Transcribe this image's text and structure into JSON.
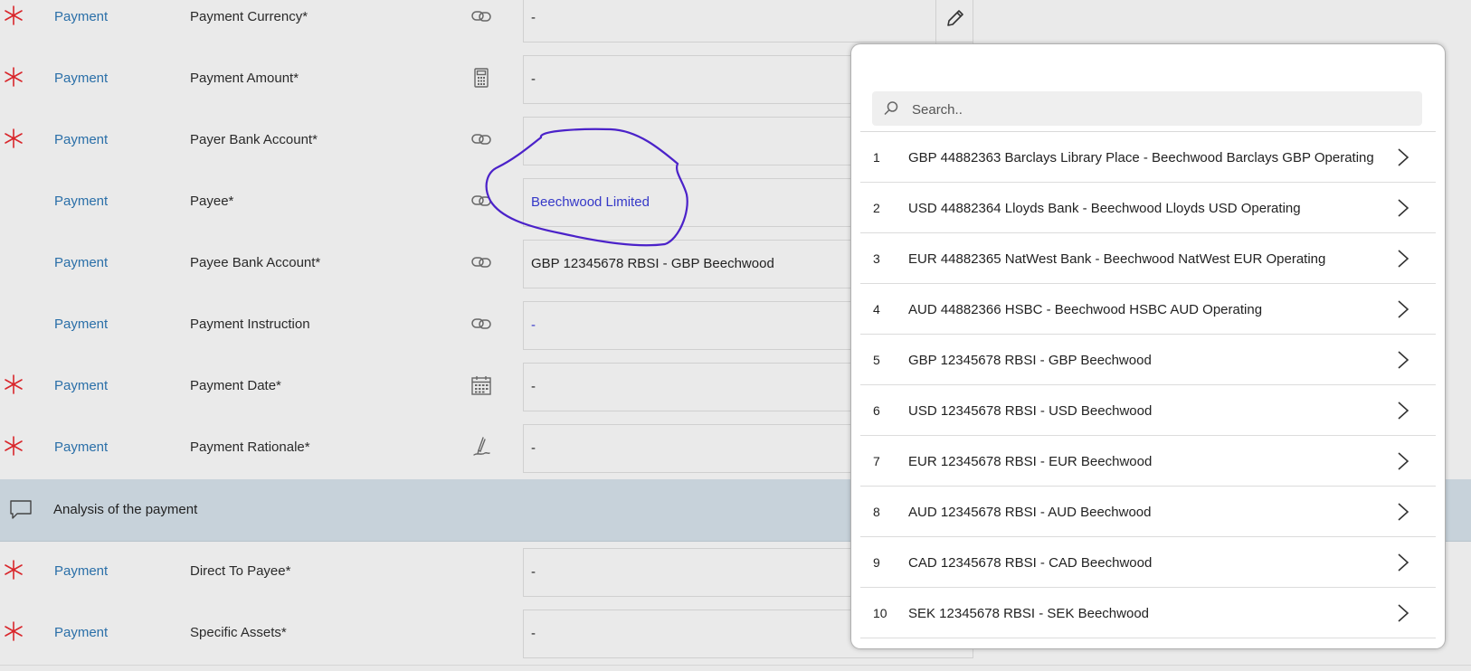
{
  "edit_icon": "pencil-icon",
  "required_icon": "asterisk-icon",
  "rows": [
    {
      "required": true,
      "section": "Payment",
      "label": "Payment Currency*",
      "icon": "link-icon",
      "value": "-",
      "is_link": false
    },
    {
      "required": true,
      "section": "Payment",
      "label": "Payment Amount*",
      "icon": "calculator-icon",
      "value": "-",
      "is_link": false
    },
    {
      "required": true,
      "section": "Payment",
      "label": "Payer Bank Account*",
      "icon": "link-icon",
      "value": "",
      "is_link": false
    },
    {
      "required": false,
      "section": "Payment",
      "label": "Payee*",
      "icon": "link-icon",
      "value": "Beechwood Limited",
      "is_link": true
    },
    {
      "required": false,
      "section": "Payment",
      "label": "Payee Bank Account*",
      "icon": "link-icon",
      "value": "GBP 12345678 RBSI - GBP Beechwood",
      "is_link": false
    },
    {
      "required": false,
      "section": "Payment",
      "label": "Payment Instruction",
      "icon": "link-icon",
      "value": "-",
      "is_link": true
    },
    {
      "required": true,
      "section": "Payment",
      "label": "Payment Date*",
      "icon": "calendar-icon",
      "value": "-",
      "is_link": false
    },
    {
      "required": true,
      "section": "Payment",
      "label": "Payment Rationale*",
      "icon": "pen-icon",
      "value": "-",
      "is_link": false
    }
  ],
  "section_header": {
    "title": "Analysis of the payment",
    "icon": "comment-icon"
  },
  "rows_after": [
    {
      "required": true,
      "section": "Payment",
      "label": "Direct To Payee*",
      "value": "-"
    },
    {
      "required": true,
      "section": "Payment",
      "label": "Specific Assets*",
      "value": "-"
    }
  ],
  "popup": {
    "search": {
      "placeholder": "Search..",
      "value": ""
    },
    "items": [
      {
        "num": "1",
        "label": "GBP 44882363 Barclays Library Place - Beechwood Barclays GBP Operating"
      },
      {
        "num": "2",
        "label": "USD 44882364 Lloyds Bank - Beechwood Lloyds USD Operating"
      },
      {
        "num": "3",
        "label": "EUR 44882365 NatWest Bank - Beechwood NatWest EUR Operating"
      },
      {
        "num": "4",
        "label": "AUD 44882366 HSBC - Beechwood HSBC AUD Operating"
      },
      {
        "num": "5",
        "label": "GBP 12345678 RBSI - GBP Beechwood"
      },
      {
        "num": "6",
        "label": "USD 12345678 RBSI - USD Beechwood"
      },
      {
        "num": "7",
        "label": "EUR 12345678 RBSI - EUR Beechwood"
      },
      {
        "num": "8",
        "label": "AUD 12345678 RBSI - AUD Beechwood"
      },
      {
        "num": "9",
        "label": "CAD 12345678 RBSI - CAD Beechwood"
      },
      {
        "num": "10",
        "label": "SEK 12345678 RBSI - SEK Beechwood"
      }
    ]
  },
  "colors": {
    "section_link": "#2a6fa8",
    "required": "#d9262b",
    "value_link": "#3538c8",
    "annotation": "#4b22c9",
    "section_header_bg": "#c7d2da"
  }
}
